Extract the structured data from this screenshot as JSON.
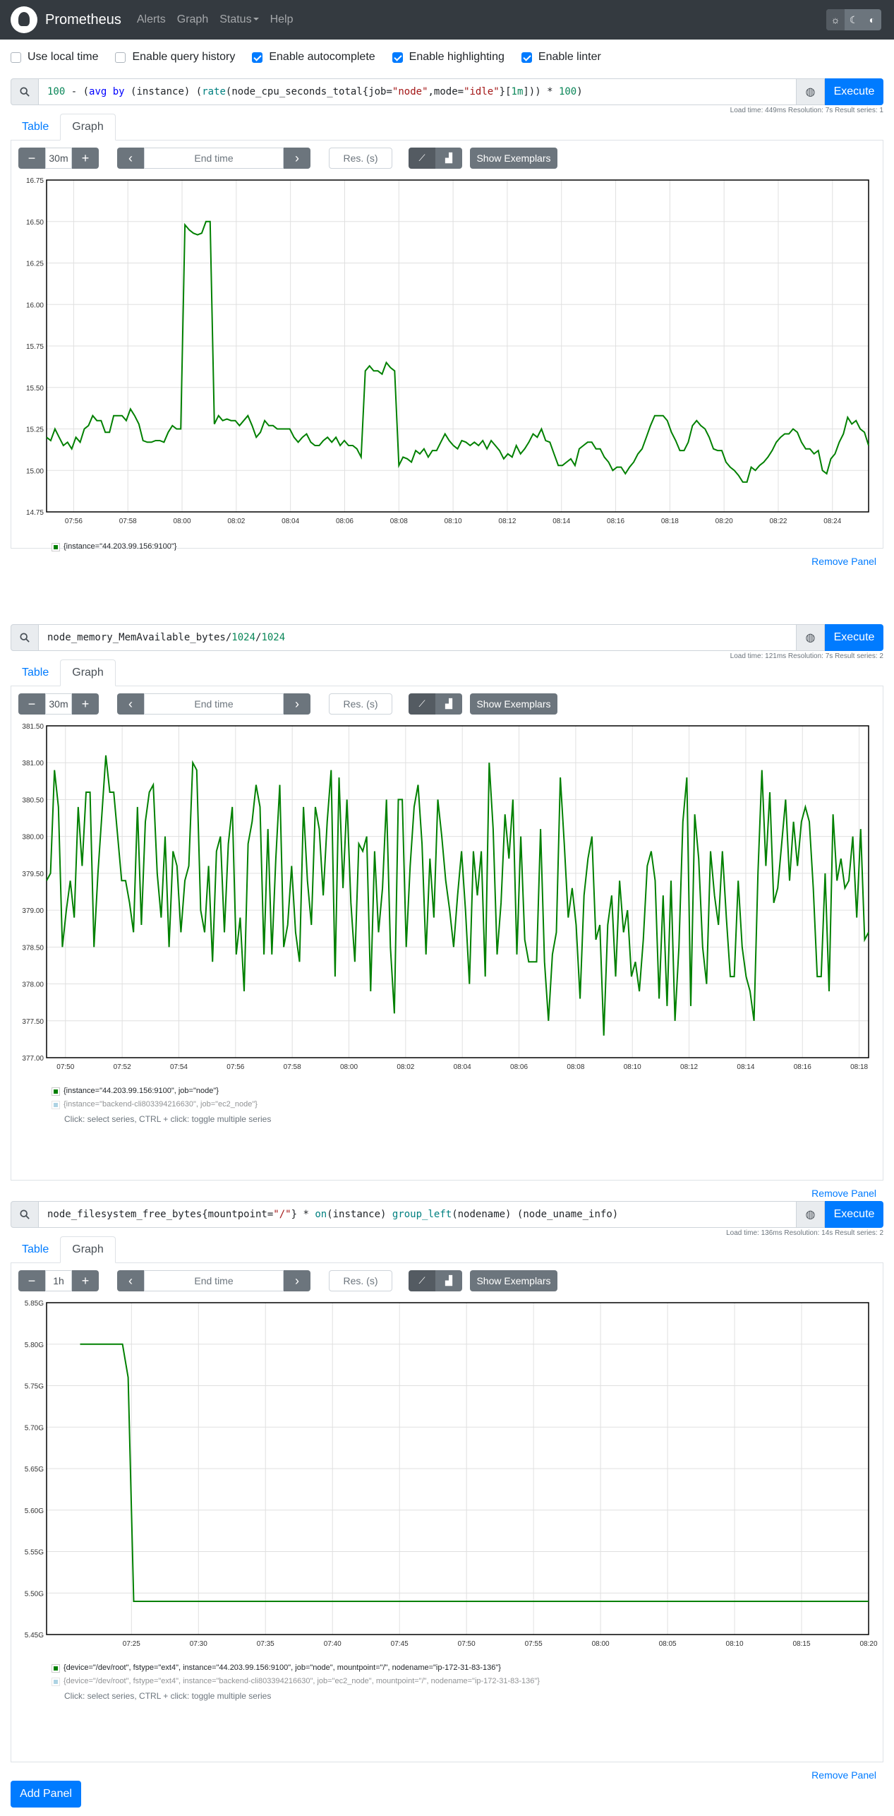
{
  "nav": {
    "brand": "Prometheus",
    "links": [
      "Alerts",
      "Graph",
      "Status",
      "Help"
    ]
  },
  "options": [
    {
      "label": "Use local time",
      "checked": false
    },
    {
      "label": "Enable query history",
      "checked": false
    },
    {
      "label": "Enable autocomplete",
      "checked": true
    },
    {
      "label": "Enable highlighting",
      "checked": true
    },
    {
      "label": "Enable linter",
      "checked": true
    }
  ],
  "ui": {
    "execute": "Execute",
    "tab_table": "Table",
    "tab_graph": "Graph",
    "minus": "−",
    "plus": "+",
    "end_time_placeholder": "End time",
    "res_placeholder": "Res. (s)",
    "show_exemplars": "Show Exemplars",
    "remove_panel": "Remove Panel",
    "add_panel": "Add Panel",
    "hint": "Click: select series, CTRL + click: toggle multiple series"
  },
  "panels": [
    {
      "query": "100 - (avg by (instance) (rate(node_cpu_seconds_total{job=\"node\",mode=\"idle\"}[1m])) * 100)",
      "stats": "Load time: 449ms   Resolution: 7s   Result series: 1",
      "range": "30m"
    },
    {
      "query": "node_memory_MemAvailable_bytes/1024/1024",
      "stats": "Load time: 121ms   Resolution: 7s   Result series: 2",
      "range": "30m"
    },
    {
      "query": "node_filesystem_free_bytes{mountpoint=\"/\"} * on(instance) group_left(nodename) (node_uname_info)",
      "stats": "Load time: 136ms   Resolution: 14s   Result series: 2",
      "range": "1h"
    }
  ],
  "legends": {
    "p1": [
      {
        "text": "{instance=\"44.203.99.156:9100\"}",
        "color": "#008000"
      }
    ],
    "p2": [
      {
        "text": "{instance=\"44.203.99.156:9100\", job=\"node\"}",
        "color": "#008000"
      },
      {
        "text": "{instance=\"backend-cli803394216630\", job=\"ec2_node\"}",
        "color": "#5fa8c8"
      }
    ],
    "p3": [
      {
        "text": "{device=\"/dev/root\", fstype=\"ext4\", instance=\"44.203.99.156:9100\", job=\"node\", mountpoint=\"/\", nodename=\"ip-172-31-83-136\"}",
        "color": "#008000"
      },
      {
        "text": "{device=\"/dev/root\", fstype=\"ext4\", instance=\"backend-cli803394216630\", job=\"ec2_node\", mountpoint=\"/\", nodename=\"ip-172-31-83-136\"}",
        "color": "#5fa8c8"
      }
    ]
  },
  "chart_data": [
    {
      "type": "line",
      "ylim": [
        14.75,
        16.75
      ],
      "yticks": [
        "14.75",
        "15.00",
        "15.25",
        "15.50",
        "15.75",
        "16.00",
        "16.25",
        "16.50",
        "16.75"
      ],
      "xticks": [
        "07:56",
        "07:58",
        "08:00",
        "08:02",
        "08:04",
        "08:06",
        "08:08",
        "08:10",
        "08:12",
        "08:14",
        "08:16",
        "08:18",
        "08:20",
        "08:22",
        "08:24"
      ],
      "xlim": [
        "07:55:00",
        "08:25:20"
      ],
      "series": [
        {
          "values": [
            15.2,
            15.18,
            15.25,
            15.2,
            15.15,
            15.17,
            15.13,
            15.2,
            15.17,
            15.25,
            15.27,
            15.33,
            15.3,
            15.3,
            15.23,
            15.23,
            15.33,
            15.33,
            15.33,
            15.3,
            15.37,
            15.33,
            15.28,
            15.18,
            15.17,
            15.17,
            15.18,
            15.18,
            15.17,
            15.23,
            15.27,
            15.25,
            15.25,
            16.48,
            16.45,
            16.43,
            16.42,
            16.43,
            16.5,
            16.5,
            15.28,
            15.33,
            15.3,
            15.31,
            15.3,
            15.3,
            15.27,
            15.3,
            15.33,
            15.27,
            15.2,
            15.23,
            15.3,
            15.27,
            15.27,
            15.25,
            15.25,
            15.25,
            15.25,
            15.2,
            15.17,
            15.2,
            15.22,
            15.17,
            15.15,
            15.15,
            15.18,
            15.2,
            15.17,
            15.2,
            15.15,
            15.18,
            15.15,
            15.15,
            15.13,
            15.08,
            15.6,
            15.63,
            15.6,
            15.6,
            15.58,
            15.65,
            15.62,
            15.6,
            15.03,
            15.08,
            15.07,
            15.05,
            15.12,
            15.1,
            15.13,
            15.08,
            15.12,
            15.12,
            15.17,
            15.22,
            15.18,
            15.15,
            15.13,
            15.18,
            15.17,
            15.15,
            15.17,
            15.15,
            15.18,
            15.13,
            15.18,
            15.15,
            15.12,
            15.07,
            15.1,
            15.08,
            15.15,
            15.1,
            15.13,
            15.17,
            15.22,
            15.2,
            15.25,
            15.18,
            15.17,
            15.1,
            15.03,
            15.03,
            15.05,
            15.07,
            15.03,
            15.13,
            15.15,
            15.17,
            15.17,
            15.13,
            15.13,
            15.08,
            15.05,
            15.0,
            15.02,
            15.02,
            14.98,
            15.02,
            15.05,
            15.1,
            15.13,
            15.2,
            15.27,
            15.33,
            15.33,
            15.33,
            15.3,
            15.23,
            15.18,
            15.12,
            15.12,
            15.17,
            15.27,
            15.3,
            15.27,
            15.25,
            15.2,
            15.13,
            15.12,
            15.12,
            15.05,
            15.02,
            15.0,
            14.97,
            14.93,
            14.93,
            15.02,
            15.0,
            15.03,
            15.05,
            15.08,
            15.12,
            15.17,
            15.2,
            15.22,
            15.22,
            15.25,
            15.23,
            15.17,
            15.13,
            15.13,
            15.1,
            15.12,
            15.0,
            14.98,
            15.07,
            15.1,
            15.17,
            15.22,
            15.32,
            15.28,
            15.3,
            15.25,
            15.23,
            15.15
          ]
        }
      ]
    },
    {
      "type": "line",
      "ylim": [
        377.0,
        381.5
      ],
      "yticks": [
        "377.00",
        "377.50",
        "378.00",
        "378.50",
        "379.00",
        "379.50",
        "380.00",
        "380.50",
        "381.00",
        "381.50"
      ],
      "xticks": [
        "07:50",
        "07:52",
        "07:54",
        "07:56",
        "07:58",
        "08:00",
        "08:02",
        "08:04",
        "08:06",
        "08:08",
        "08:10",
        "08:12",
        "08:14",
        "08:16",
        "08:18"
      ],
      "xlim": [
        "07:49:20",
        "08:18:20"
      ],
      "series": [
        {
          "values": [
            379.4,
            379.5,
            380.9,
            380.4,
            378.5,
            379,
            379.4,
            378.9,
            380.4,
            379.6,
            380.6,
            380.6,
            378.5,
            379.5,
            380.3,
            381.1,
            380.6,
            380.6,
            380,
            379.4,
            379.4,
            379.1,
            378.7,
            380.4,
            378.8,
            380.2,
            380.6,
            380.7,
            379.5,
            378.9,
            380,
            378.5,
            379.8,
            379.6,
            378.7,
            379.4,
            379.6,
            381,
            380.9,
            379,
            378.7,
            379.6,
            378.3,
            379.8,
            380,
            378.7,
            379.9,
            380.4,
            378.4,
            378.9,
            377.9,
            379.9,
            380.2,
            380.7,
            380.4,
            378.4,
            380.1,
            378.4,
            379.7,
            380.7,
            378.5,
            378.8,
            379.6,
            378.7,
            378.3,
            380.4,
            379.4,
            378.8,
            380.4,
            380.1,
            379.2,
            380.2,
            380.9,
            378.1,
            380.8,
            379.3,
            380.5,
            379.1,
            378.3,
            379.9,
            379.8,
            380,
            377.9,
            379.8,
            378.7,
            379.3,
            380.5,
            378.5,
            377.6,
            380.5,
            380.5,
            378.5,
            379.6,
            380.4,
            380.7,
            379.9,
            378.4,
            379.7,
            378.9,
            380.5,
            380,
            379.4,
            379,
            378.5,
            379.2,
            379.8,
            379,
            378,
            379.8,
            379.2,
            379.8,
            378.1,
            381,
            380.1,
            378.4,
            379.1,
            380.3,
            379.7,
            380.5,
            378.4,
            380,
            378.6,
            378.3,
            378.3,
            378.3,
            380.1,
            378.3,
            377.5,
            378.4,
            378.7,
            380.8,
            379.9,
            378.9,
            379.3,
            378.8,
            377.8,
            379.2,
            379.7,
            380,
            378.6,
            378.8,
            377.3,
            378.8,
            379.2,
            378.1,
            379.4,
            378.7,
            379,
            378.1,
            378.3,
            377.9,
            378.6,
            379.6,
            379.8,
            379.4,
            377.8,
            379.2,
            377.7,
            379.4,
            377.5,
            378.5,
            380.2,
            380.8,
            377.7,
            380.3,
            379.7,
            378.5,
            378,
            379.8,
            379.2,
            378.8,
            379.8,
            378.9,
            378.1,
            378.1,
            379.4,
            378.5,
            378.1,
            377.9,
            377.5,
            379.5,
            380.9,
            379.6,
            380.6,
            379.1,
            379.3,
            379.9,
            380.5,
            379.4,
            380.2,
            379.6,
            380.2,
            380.4,
            380.2,
            379.3,
            378.1,
            378.1,
            379.5,
            377.9,
            380.3,
            379.4,
            379.7,
            379.3,
            379.4,
            380,
            378.9,
            380.1,
            378.6,
            378.7
          ]
        }
      ]
    },
    {
      "type": "line",
      "ylim": [
        5.45,
        5.85
      ],
      "yticks": [
        "5.45G",
        "5.50G",
        "5.55G",
        "5.60G",
        "5.65G",
        "5.70G",
        "5.75G",
        "5.80G",
        "5.85G"
      ],
      "xticks": [
        "07:25",
        "07:30",
        "07:35",
        "07:40",
        "07:45",
        "07:50",
        "07:55",
        "08:00",
        "08:05",
        "08:10",
        "08:15",
        "08:20"
      ],
      "xlim": [
        "07:18:40",
        "08:20:00"
      ],
      "series": [
        {
          "points": [
            [
              "07:21:10",
              5.8
            ],
            [
              "07:24:20",
              5.8
            ],
            [
              "07:24:45",
              5.76
            ],
            [
              "07:25:10",
              5.49
            ],
            [
              "08:20:00",
              5.49
            ]
          ]
        }
      ]
    }
  ],
  "colors": {
    "series": "#008000",
    "navbar": "#343a40",
    "primary": "#007bff",
    "secondary": "#6c757d"
  }
}
